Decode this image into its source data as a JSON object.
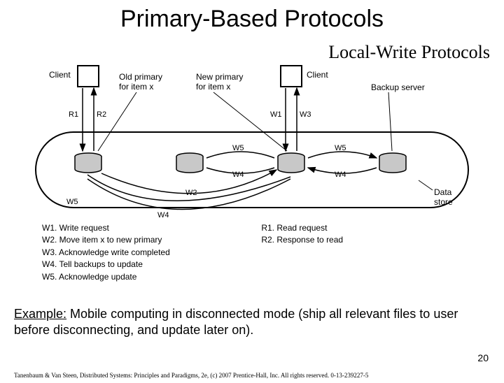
{
  "title": "Primary-Based Protocols",
  "subtitle": "Local-Write Protocols",
  "diagram": {
    "client_left_label": "Client",
    "client_right_label": "Client",
    "old_primary_label": "Old primary\nfor item x",
    "new_primary_label": "New primary\nfor item x",
    "backup_server_label": "Backup server",
    "data_store_label": "Data store",
    "r1": "R1",
    "r2": "R2",
    "w1": "W1",
    "w2": "W2",
    "w3": "W3",
    "w4": "W4",
    "w5": "W5",
    "w4_mid": "W4",
    "w5_mid": "W5",
    "w4_left": "W4",
    "w5_left": "W5"
  },
  "legend": {
    "w1": "W1. Write request",
    "w2": "W2. Move item x to new primary",
    "w3": "W3. Acknowledge write completed",
    "w4": "W4. Tell backups to update",
    "w5": "W5. Acknowledge update",
    "r1": "R1. Read request",
    "r2": "R2. Response to read"
  },
  "example_label": "Example:",
  "example_text": " Mobile computing in disconnected mode (ship all relevant files to user before disconnecting, and update later on).",
  "pagenum": "20",
  "footer": "Tanenbaum & Van Steen, Distributed Systems: Principles and Paradigms, 2e, (c) 2007 Prentice-Hall, Inc. All rights reserved. 0-13-239227-5"
}
